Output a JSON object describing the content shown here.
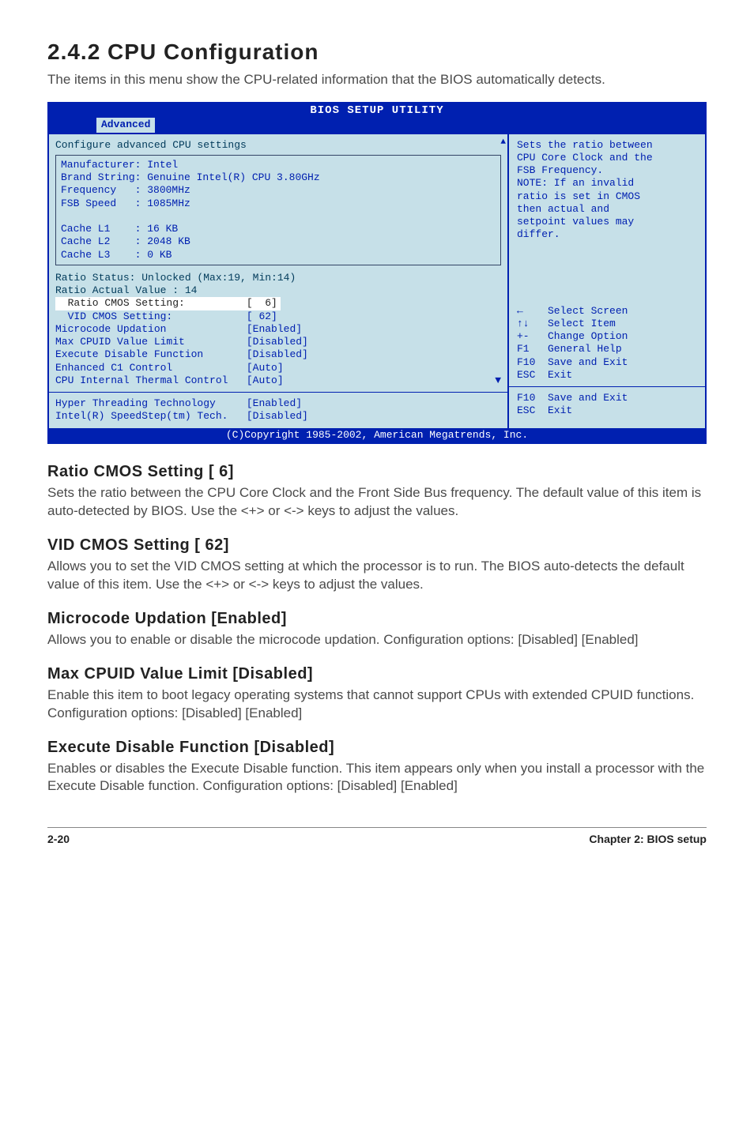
{
  "heading": {
    "number_title": "2.4.2   CPU Configuration",
    "intro": "The items in this menu show the CPU-related information that the BIOS automatically detects."
  },
  "bios": {
    "title": "BIOS SETUP UTILITY",
    "tab": "Advanced",
    "left_header": "Configure advanced CPU settings",
    "info": {
      "l1": "Manufacturer: Intel",
      "l2": "Brand String: Genuine Intel(R) CPU 3.80GHz",
      "l3": "Frequency   : 3800MHz",
      "l4": "FSB Speed   : 1085MHz",
      "l5": "",
      "l6": "Cache L1    : 16 KB",
      "l7": "Cache L2    : 2048 KB",
      "l8": "Cache L3    : 0 KB"
    },
    "status": {
      "s1": "Ratio Status: Unlocked (Max:19, Min:14)",
      "s2": "Ratio Actual Value : 14"
    },
    "items": {
      "ratio_label": "  Ratio CMOS Setting:          [  6]",
      "vid": "  VID CMOS Setting:            [ 62]",
      "microcode": "Microcode Updation             [Enabled]",
      "maxcpuid": "Max CPUID Value Limit          [Disabled]",
      "execdis": "Execute Disable Function       [Disabled]",
      "c1": "Enhanced C1 Control            [Auto]",
      "thermal": "CPU Internal Thermal Control   [Auto]"
    },
    "bottom": {
      "ht": "Hyper Threading Technology     [Enabled]",
      "ss": "Intel(R) SpeedStep(tm) Tech.   [Disabled]"
    },
    "right": {
      "help1": "Sets the ratio between",
      "help2": "CPU Core Clock and the",
      "help3": "FSB Frequency.",
      "help4": "NOTE: If an invalid",
      "help5": "ratio is set in CMOS",
      "help6": "then actual and",
      "help7": "setpoint values may",
      "help8": "differ.",
      "k1": "←    Select Screen",
      "k2": "↑↓   Select Item",
      "k3": "+-   Change Option",
      "k4": "F1   General Help",
      "k5": "F10  Save and Exit",
      "k6": "ESC  Exit",
      "k7": "F10  Save and Exit",
      "k8": "ESC  Exit"
    },
    "copyright": "(C)Copyright 1985-2002, American Megatrends, Inc."
  },
  "sections": {
    "ratio": {
      "title": "Ratio CMOS Setting [ 6]",
      "body": "Sets the ratio between the CPU Core Clock and the Front Side Bus frequency. The default value of this item is auto-detected by BIOS. Use the <+> or <-> keys to adjust the values."
    },
    "vid": {
      "title": "VID CMOS Setting [ 62]",
      "body": "Allows you to set the VID CMOS setting at which the processor is to run. The BIOS auto-detects the default value of this item. Use the <+> or  <-> keys to adjust the values."
    },
    "micro": {
      "title": "Microcode Updation [Enabled]",
      "body": "Allows you to enable or disable the microcode updation. Configuration options: [Disabled] [Enabled]"
    },
    "max": {
      "title": "Max CPUID Value Limit [Disabled]",
      "body": "Enable this item to boot legacy operating systems that cannot support CPUs with extended CPUID functions. Configuration options: [Disabled] [Enabled]"
    },
    "exec": {
      "title": "Execute Disable Function [Disabled]",
      "body": "Enables or disables the Execute Disable function. This item appears only when you install a processor with the Execute Disable function. Configuration options: [Disabled] [Enabled]"
    }
  },
  "footer": {
    "left": "2-20",
    "right": "Chapter 2: BIOS setup"
  }
}
